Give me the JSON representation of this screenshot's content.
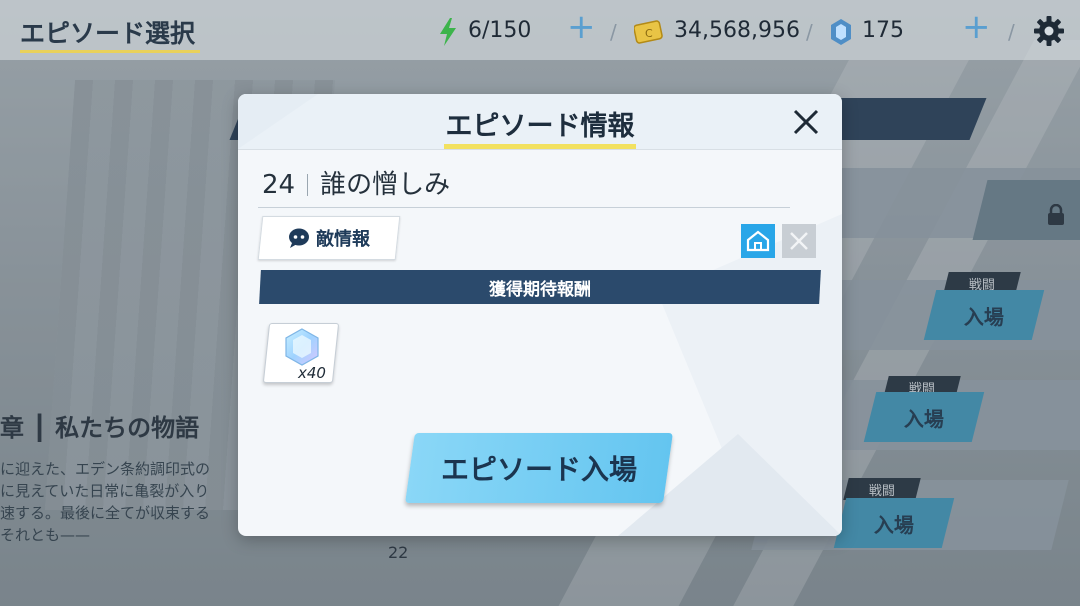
{
  "header": {
    "title": "エピソード選択",
    "stamina": "6/150",
    "credits": "34,568,956",
    "gems": "175"
  },
  "background": {
    "chapter_title": "章 ┃ 私たちの物語",
    "chapter_desc": [
      "に迎えた、エデン条約調印式の",
      "に見えていた日常に亀裂が入り",
      "速する。最後に全てが収束する",
      "それとも——"
    ],
    "episode_list_number": "22",
    "battle_tag": "戦闘",
    "enter_label": "入場",
    "locked_label": "入場"
  },
  "modal": {
    "title": "エピソード情報",
    "episode_number": "24",
    "episode_name": "誰の憎しみ",
    "enemy_info_label": "敵情報",
    "reward_header": "獲得期待報酬",
    "reward_item_qty": "x40",
    "enter_button_label": "エピソード入場"
  },
  "colors": {
    "accent_yellow": "#f2e160",
    "dark_navy": "#2b4a6c",
    "enter_blue": "#64c5f0",
    "home_blue": "#29a6e8"
  },
  "icons": [
    "stamina-bolt-icon",
    "credit-card-icon",
    "gem-icon",
    "plus-icon",
    "gear-icon",
    "close-icon",
    "enemy-icon",
    "home-icon",
    "lock-icon",
    "sword-icon"
  ]
}
